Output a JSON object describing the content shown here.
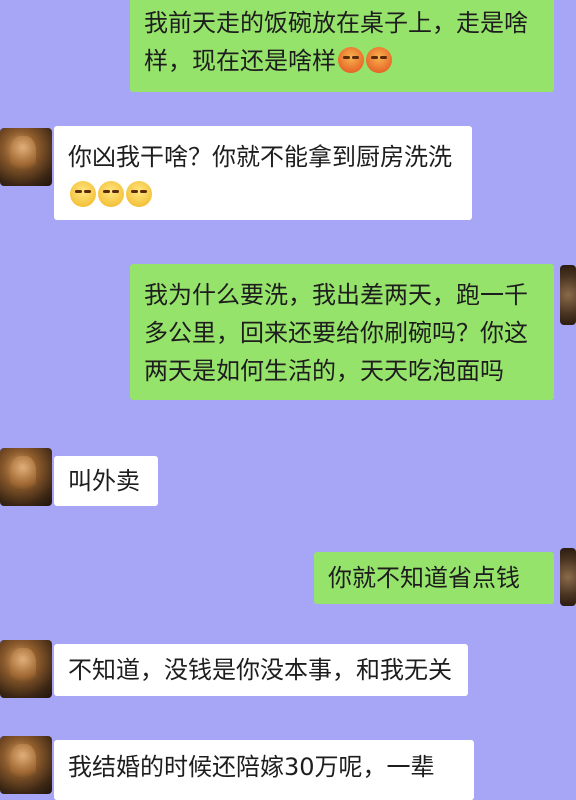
{
  "messages": [
    {
      "side": "right",
      "text": "我前天走的饭碗放在桌子上，走是啥样，现在还是啥样",
      "emojis": [
        "angry-face",
        "angry-face"
      ]
    },
    {
      "side": "left",
      "text": "你凶我干啥？你就不能拿到厨房洗洗",
      "emojis": [
        "relieved-face",
        "relieved-face",
        "relieved-face"
      ]
    },
    {
      "side": "right",
      "text": "我为什么要洗，我出差两天，跑一千多公里，回来还要给你刷碗吗？你这两天是如何生活的，天天吃泡面吗",
      "emojis": []
    },
    {
      "side": "left",
      "text": "叫外卖",
      "emojis": []
    },
    {
      "side": "right",
      "text": "你就不知道省点钱",
      "emojis": []
    },
    {
      "side": "left",
      "text": "不知道，没钱是你没本事，和我无关",
      "emojis": []
    },
    {
      "side": "left",
      "text": "我结婚的时候还陪嫁30万呢，一辈",
      "emojis": []
    }
  ],
  "colors": {
    "background": "#a7a5f6",
    "outgoing": "#96e36b",
    "incoming": "#ffffff"
  }
}
